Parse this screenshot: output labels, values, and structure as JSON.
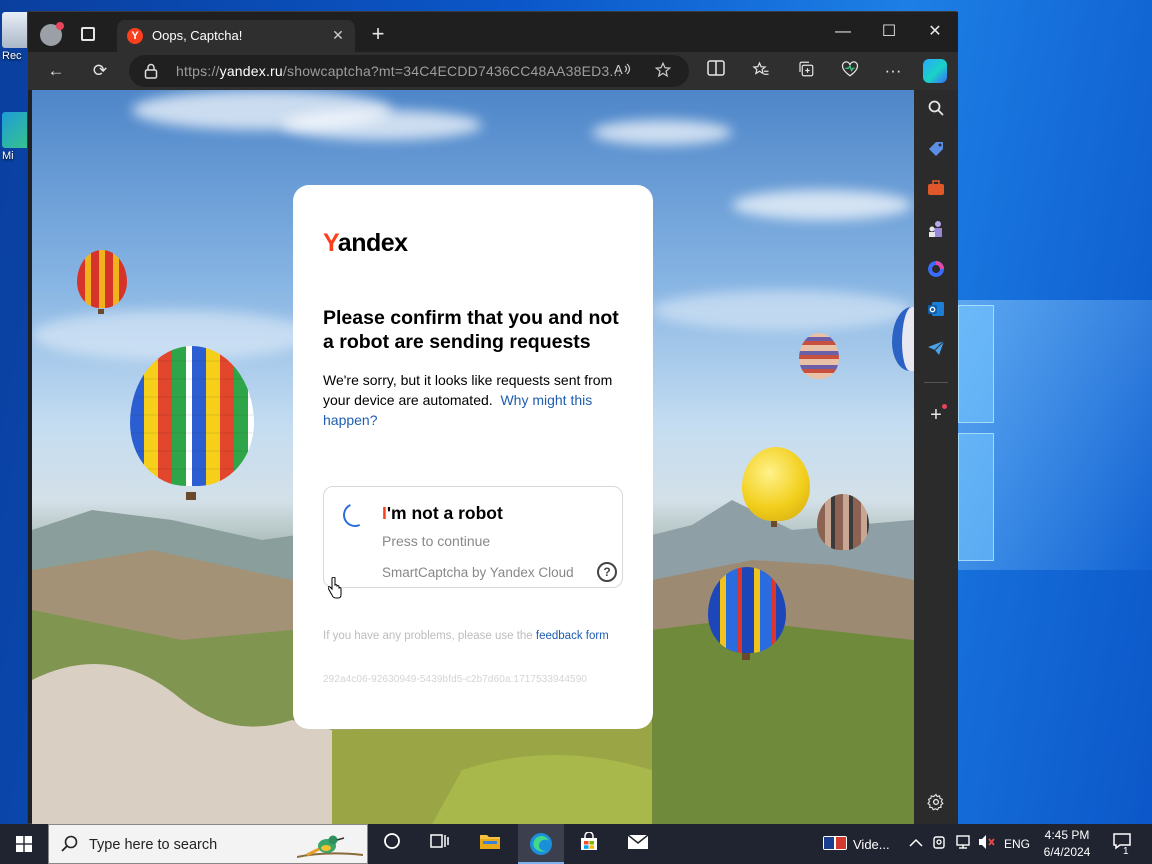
{
  "desktop": {
    "icons": [
      {
        "label": "Rec"
      },
      {
        "label": "Mi"
      }
    ]
  },
  "browser": {
    "tab": {
      "favicon": "Y",
      "title": "Oops, Captcha!"
    },
    "address": {
      "scheme": "https://",
      "host": "yandex.ru",
      "path": "/showcaptcha?mt=34C4ECDD7436CC48AA38ED3..."
    },
    "icons": {
      "back": "←",
      "reload": "⟳",
      "new_tab": "+",
      "close_tab": "✕",
      "minimize": "—",
      "maximize": "☐",
      "close": "✕",
      "more": "···"
    }
  },
  "captcha": {
    "logo_first": "Y",
    "logo_rest": "andex",
    "headline": "Please confirm that you and not a robot are sending requests",
    "desc_text": "We're sorry, but it looks like requests sent from your device are automated.",
    "desc_link": "Why might this happen?",
    "check_label_first": "I",
    "check_label_rest": "'m not a robot",
    "check_sub": "Press to continue",
    "smartcaptcha": "SmartCaptcha by Yandex Cloud",
    "help": "?",
    "footnote_text": "If you have any problems, please use the",
    "footnote_link": "feedback form",
    "request_id": "292a4c06-92630949-5439bfd5-c2b7d60a:1717533944590"
  },
  "taskbar": {
    "search_placeholder": "Type here to search",
    "video_label": "Vide...",
    "language": "ENG",
    "time": "4:45 PM",
    "date": "6/4/2024",
    "notification_count": "1"
  },
  "colors": {
    "yandex_red": "#fc3f1d",
    "link_blue": "#1f5db0",
    "spinner_blue": "#2a6fdb"
  }
}
